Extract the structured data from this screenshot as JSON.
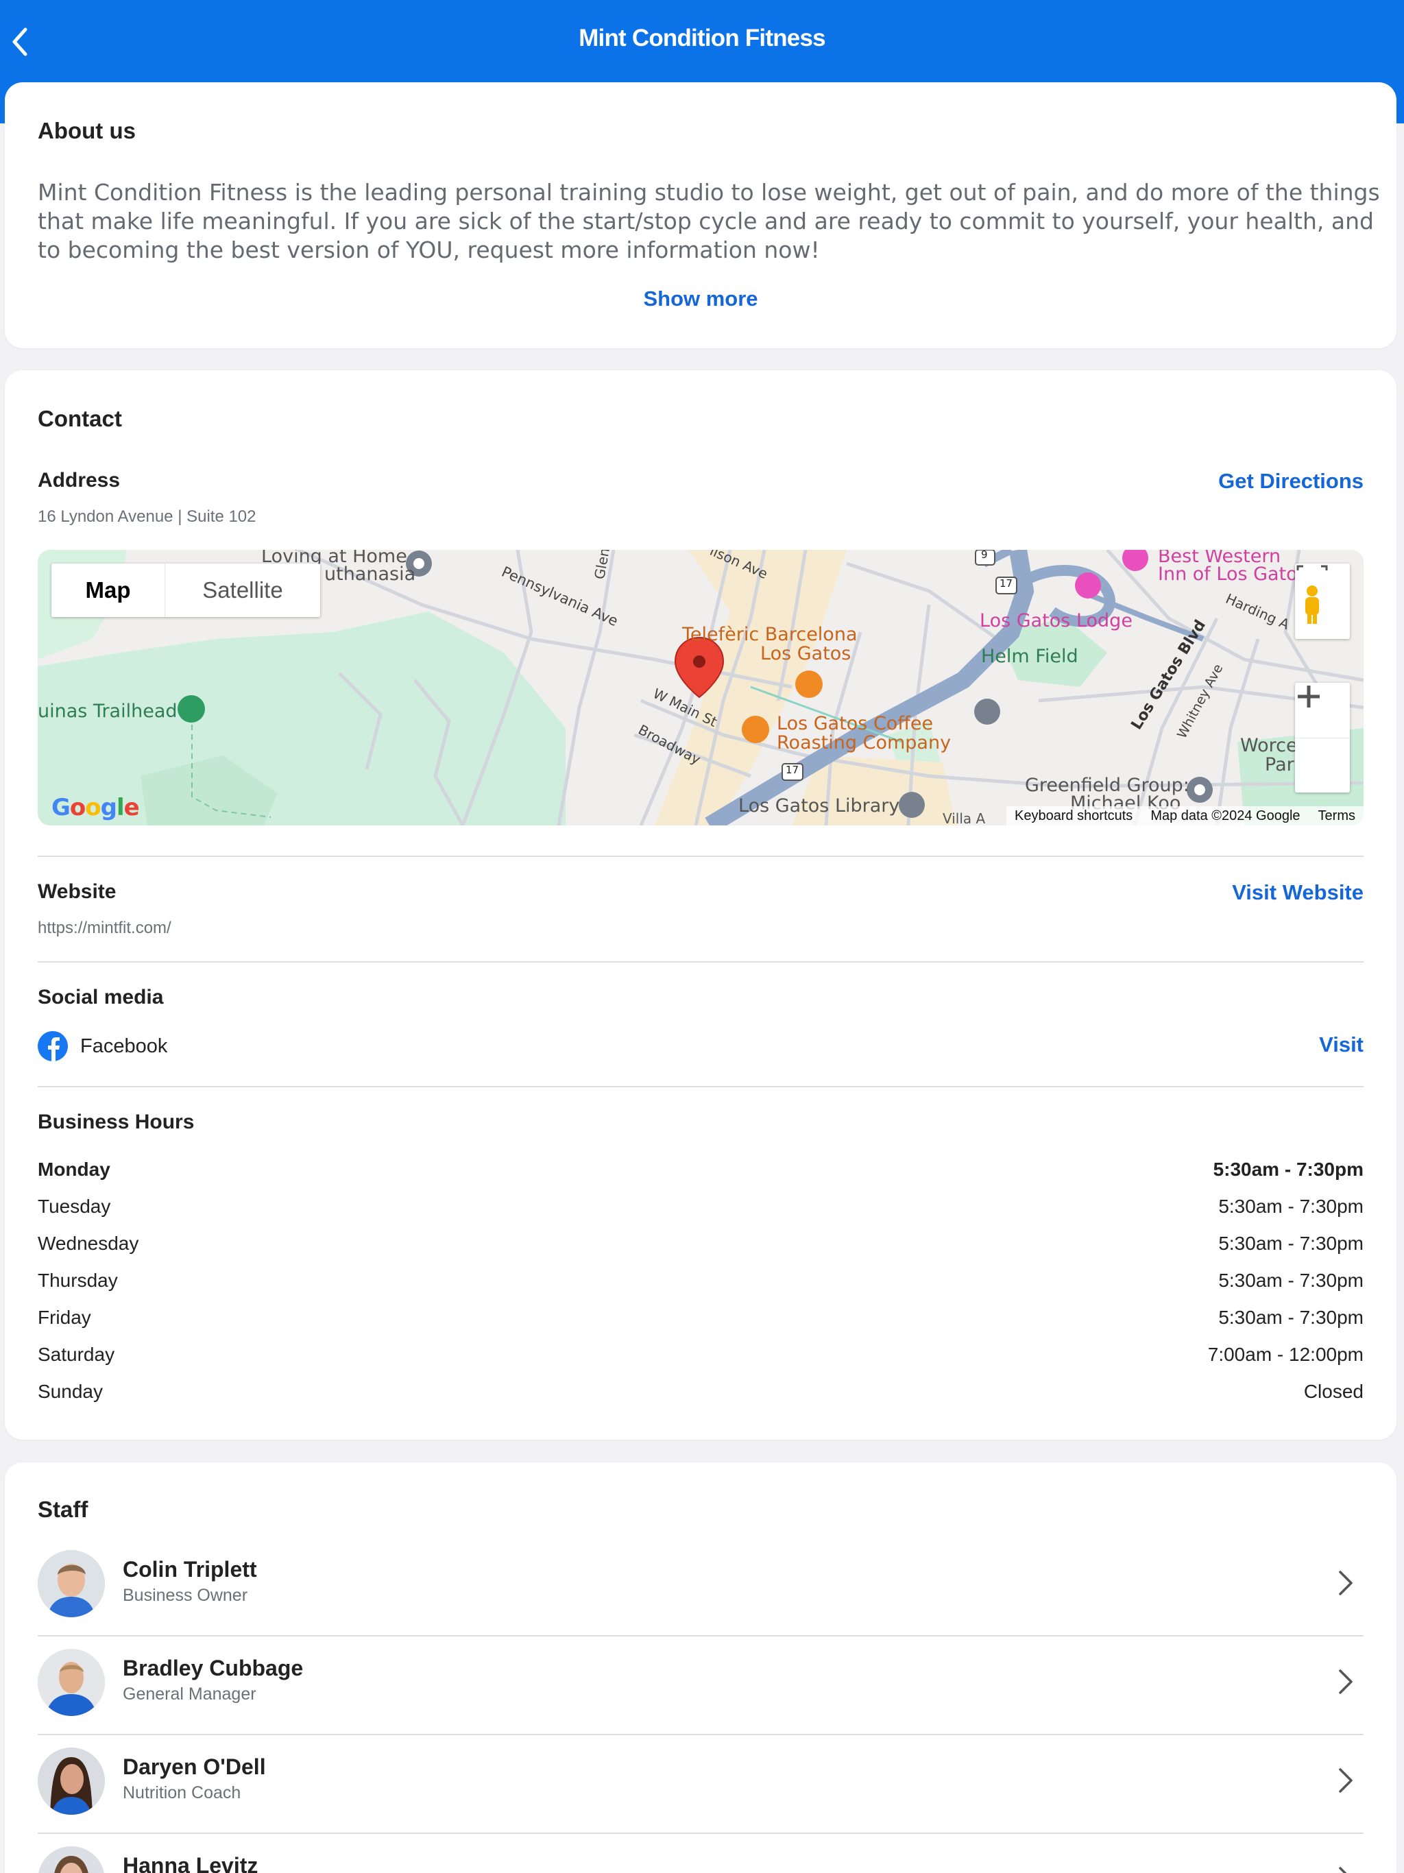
{
  "nav": {
    "title": "Mint Condition Fitness"
  },
  "about": {
    "title": "About us",
    "text": "Mint Condition Fitness is the leading personal training studio to lose weight, get out of pain, and do more of the things that make life meaningful. If you are sick of the start/stop cycle and are ready to commit to yourself, your health, and to becoming the best version of YOU, request more information now!",
    "show_more": "Show more"
  },
  "contact": {
    "title": "Contact",
    "address_label": "Address",
    "address": "16 Lyndon Avenue | Suite 102",
    "directions": "Get Directions",
    "map": {
      "tab_map": "Map",
      "tab_satellite": "Satellite",
      "labels": {
        "loving_home": "Loving at Home",
        "euthanasia": "uthanasia",
        "pennsylvania": "Pennsylvania Ave",
        "glen": "Glen",
        "wilson": "ilson Ave",
        "trailhead": "uinas Trailhead",
        "teleferic1": "Telefèric Barcelona",
        "teleferic2": "Los Gatos",
        "w_main": "W Main St",
        "broadway": "Broadway",
        "coffee1": "Los Gatos Coffee",
        "coffee2": "Roasting Company",
        "library": "Los Gatos Library",
        "villa": "Villa A",
        "best_western1": "Best Western",
        "best_western2": "Inn of Los Gato",
        "lodge": "Los Gatos Lodge",
        "harding": "Harding A",
        "helm": "Helm Field",
        "los_gatos_blvd": "Los Gatos Blvd",
        "whitney": "Whitney Ave",
        "greenfield1": "Greenfield Group:",
        "greenfield2": "Michael Koo",
        "worce1": "Worce",
        "worce2": "Par",
        "route9": "9",
        "route17a": "17",
        "route17b": "17"
      },
      "google": [
        "G",
        "o",
        "o",
        "g",
        "l",
        "e"
      ],
      "footer_shortcuts": "Keyboard shortcuts",
      "footer_data": "Map data ©2024 Google",
      "footer_terms": "Terms"
    },
    "website_label": "Website",
    "website": "https://mintfit.com/",
    "visit_website": "Visit Website",
    "social_label": "Social media",
    "facebook": "Facebook",
    "visit": "Visit",
    "hours_label": "Business Hours",
    "hours": [
      {
        "day": "Monday",
        "time": "5:30am - 7:30pm"
      },
      {
        "day": "Tuesday",
        "time": "5:30am - 7:30pm"
      },
      {
        "day": "Wednesday",
        "time": "5:30am - 7:30pm"
      },
      {
        "day": "Thursday",
        "time": "5:30am - 7:30pm"
      },
      {
        "day": "Friday",
        "time": "5:30am - 7:30pm"
      },
      {
        "day": "Saturday",
        "time": "7:00am - 12:00pm"
      },
      {
        "day": "Sunday",
        "time": "Closed"
      }
    ]
  },
  "staff": {
    "title": "Staff",
    "members": [
      {
        "name": "Colin Triplett",
        "role": "Business Owner"
      },
      {
        "name": "Bradley Cubbage",
        "role": "General Manager"
      },
      {
        "name": "Daryen O'Dell",
        "role": "Nutrition Coach"
      },
      {
        "name": "Hanna Levitz",
        "role": ""
      }
    ]
  },
  "colors": {
    "brand": "#0b72e7",
    "link": "#1567d8",
    "facebook": "#1877f2",
    "map_pin": "#ea4335"
  }
}
